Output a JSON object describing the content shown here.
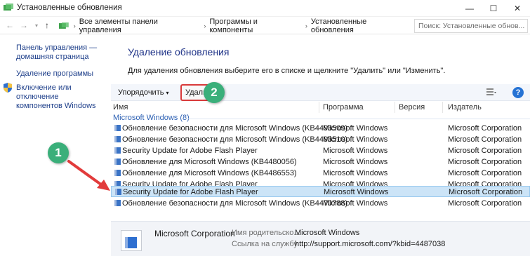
{
  "window": {
    "title": "Установленные обновления"
  },
  "address": {
    "crumbs": [
      "Все элементы панели управления",
      "Программы и компоненты",
      "Установленные обновления"
    ],
    "search_placeholder": "Поиск: Установленные обнов..."
  },
  "sidebar": {
    "items": [
      {
        "label": "Панель управления — домашняя страница"
      },
      {
        "label": "Удаление программы"
      },
      {
        "label": "Включение или отключение компонентов Windows"
      }
    ]
  },
  "main": {
    "heading": "Удаление обновления",
    "description": "Для удаления обновления выберите его в списке и щелкните \"Удалить\" или \"Изменить\"."
  },
  "toolbar": {
    "organize": "Упорядочить",
    "organize_arrow": "▾",
    "delete": "Удалить",
    "help": "?"
  },
  "columns": [
    "Имя",
    "Программа",
    "Версия",
    "Издатель"
  ],
  "group": {
    "label": "Microsoft Windows (8)"
  },
  "rows": [
    {
      "name": "Обновление безопасности для Microsoft Windows (KB4493509)",
      "program": "Microsoft Windows",
      "version": "",
      "publisher": "Microsoft Corporation"
    },
    {
      "name": "Обновление безопасности для Microsoft Windows (KB4493510)",
      "program": "Microsoft Windows",
      "version": "",
      "publisher": "Microsoft Corporation"
    },
    {
      "name": "Security Update for Adobe Flash Player",
      "program": "Microsoft Windows",
      "version": "",
      "publisher": "Microsoft Corporation"
    },
    {
      "name": "Обновление для Microsoft Windows (KB4480056)",
      "program": "Microsoft Windows",
      "version": "",
      "publisher": "Microsoft Corporation"
    },
    {
      "name": "Обновление для Microsoft Windows (KB4486553)",
      "program": "Microsoft Windows",
      "version": "",
      "publisher": "Microsoft Corporation"
    },
    {
      "name": "Security Update for Adobe Flash Player",
      "program": "Microsoft Windows",
      "version": "",
      "publisher": "Microsoft Corporation"
    },
    {
      "name": "Security Update for Adobe Flash Player",
      "program": "Microsoft Windows",
      "version": "",
      "publisher": "Microsoft Corporation",
      "selected": true
    },
    {
      "name": "Обновление безопасности для Microsoft Windows (KB4470788)",
      "program": "Microsoft Windows",
      "version": "",
      "publisher": "Microsoft Corporation"
    }
  ],
  "details": {
    "publisher": "Microsoft Corporation",
    "parent_label": "Имя родительско...",
    "parent_value": "Microsoft Windows",
    "support_label": "Ссылка на службу ...",
    "support_value": "http://support.microsoft.com/?kbid=4487038"
  },
  "annotations": {
    "badge1": "1",
    "badge2": "2"
  },
  "colors": {
    "accent": "#2673d4",
    "badge": "#3aaf7a",
    "highlight": "#d93a3a",
    "selection": "#cce4f7"
  }
}
